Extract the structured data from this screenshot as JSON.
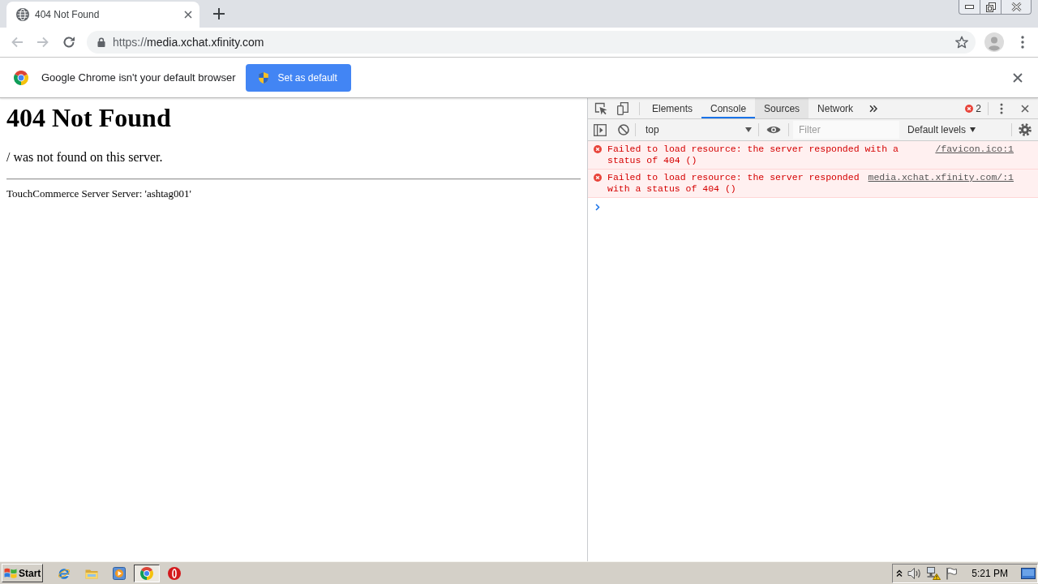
{
  "browser_tabs": [
    {
      "title": "404 Not Found",
      "selected": true
    }
  ],
  "navigation": {
    "back": {
      "disabled": true
    },
    "forward": {
      "disabled": true
    }
  },
  "address_bar": {
    "scheme": "https://",
    "host": "media.xchat.xfinity.com"
  },
  "infobar": {
    "message": "Google Chrome isn't your default browser",
    "button": "Set as default"
  },
  "page": {
    "heading": "404 Not Found",
    "message": "/ was not found on this server.",
    "signature": "TouchCommerce Server Server: 'ashtag001'"
  },
  "devtools": {
    "tabs": [
      {
        "label": "Elements",
        "selected": false,
        "hovered": false
      },
      {
        "label": "Console",
        "selected": true,
        "hovered": false
      },
      {
        "label": "Sources",
        "selected": false,
        "hovered": true
      },
      {
        "label": "Network",
        "selected": false,
        "hovered": false
      }
    ],
    "error_count": "2",
    "console_toolbar": {
      "context": "top",
      "filter": {
        "placeholder": "Filter"
      },
      "levels": "Default levels"
    },
    "messages": [
      {
        "kind": "error",
        "text": "Failed to load resource: the server responded with a status of 404 ()",
        "source": "/favicon.ico:1"
      },
      {
        "kind": "error",
        "text": "Failed to load resource: the server responded with a status of 404 ()",
        "source": "media.xchat.xfinity.com/:1"
      }
    ]
  },
  "taskbar": {
    "start": "Start",
    "apps": [
      {
        "kind": "ie",
        "selected": false
      },
      {
        "kind": "explorer",
        "selected": false
      },
      {
        "kind": "media",
        "selected": false
      },
      {
        "kind": "chrome",
        "selected": true
      },
      {
        "kind": "opera",
        "selected": false
      }
    ],
    "tray": {
      "clock": "5:21 PM"
    }
  }
}
